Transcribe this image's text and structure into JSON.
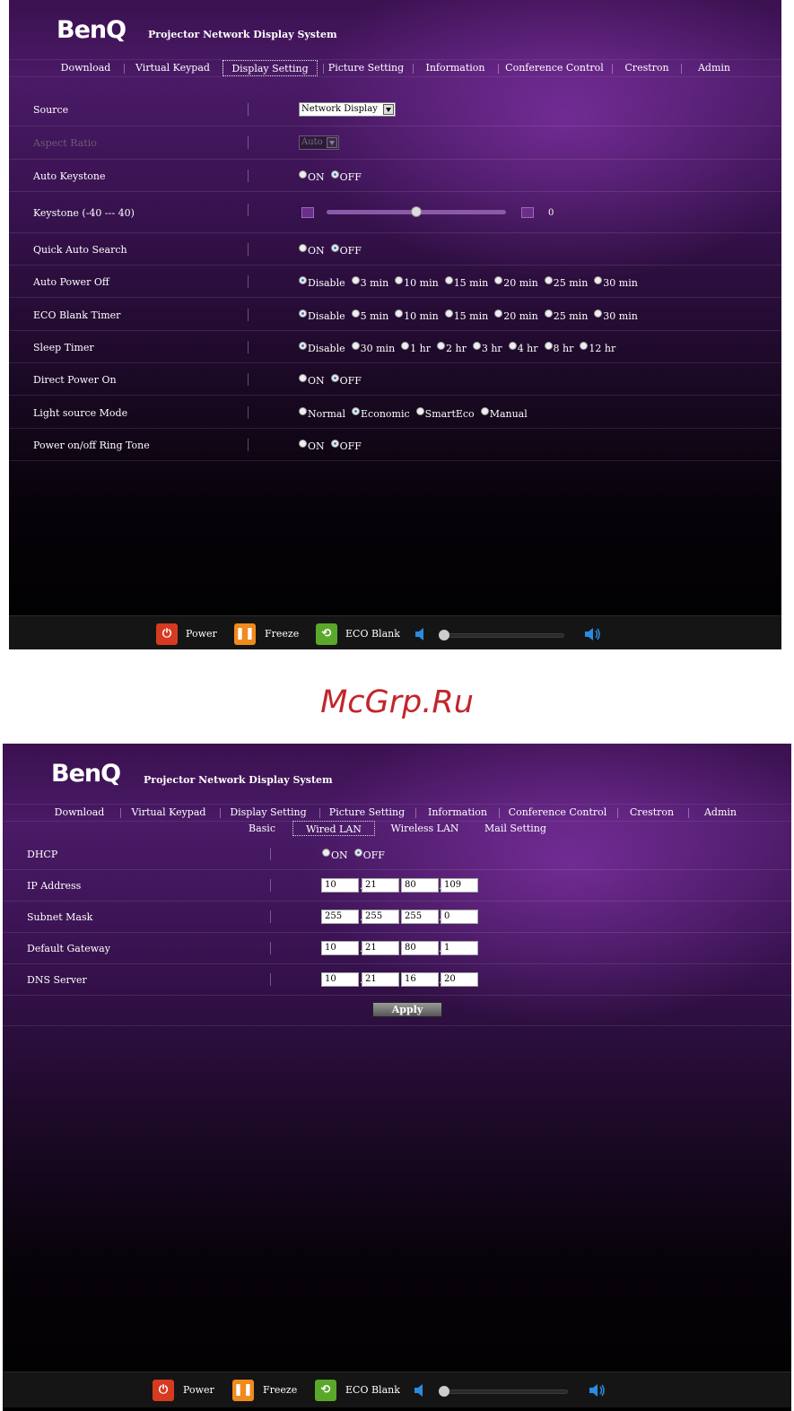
{
  "colors": {
    "accent_purple": "#4a1a66",
    "radio_checked": "#3a7ec0",
    "power_red": "#d63a20",
    "freeze_orange": "#f08a1c",
    "eco_green": "#5aa82a",
    "watermark": "#c2262b"
  },
  "screen1": {
    "brand": "BenQ",
    "subtitle": "Projector Network Display System",
    "tabs": [
      "Download",
      "Virtual Keypad",
      "Display Setting",
      "Picture Setting",
      "Information",
      "Conference Control",
      "Crestron",
      "Admin"
    ],
    "active_tab": "Display Setting",
    "rows": {
      "source": {
        "label": "Source",
        "value": "Network Display"
      },
      "aspect_ratio": {
        "label": "Aspect Ratio",
        "value": "Auto"
      },
      "auto_keystone": {
        "label": "Auto Keystone",
        "options": [
          "ON",
          "OFF"
        ],
        "selected": "OFF"
      },
      "keystone": {
        "label": "Keystone (-40 --- 40)",
        "value": "0",
        "level_fraction": 0.5
      },
      "quick_auto_search": {
        "label": "Quick Auto Search",
        "options": [
          "ON",
          "OFF"
        ],
        "selected": "OFF"
      },
      "auto_power_off": {
        "label": "Auto Power Off",
        "options": [
          "Disable",
          "3 min",
          "10 min",
          "15 min",
          "20 min",
          "25 min",
          "30 min"
        ],
        "selected": "Disable"
      },
      "eco_blank_timer": {
        "label": "ECO Blank Timer",
        "options": [
          "Disable",
          "5 min",
          "10 min",
          "15 min",
          "20 min",
          "25 min",
          "30 min"
        ],
        "selected": "Disable"
      },
      "sleep_timer": {
        "label": "Sleep Timer",
        "options": [
          "Disable",
          "30 min",
          "1 hr",
          "2 hr",
          "3 hr",
          "4 hr",
          "8 hr",
          "12 hr"
        ],
        "selected": "Disable"
      },
      "direct_power_on": {
        "label": "Direct Power On",
        "options": [
          "ON",
          "OFF"
        ],
        "selected": "OFF"
      },
      "light_source_mode": {
        "label": "Light source Mode",
        "options": [
          "Normal",
          "Economic",
          "SmartEco",
          "Manual"
        ],
        "selected": "Economic"
      },
      "ring_tone": {
        "label": "Power on/off Ring Tone",
        "options": [
          "ON",
          "OFF"
        ],
        "selected": "OFF"
      }
    },
    "footer": {
      "power": "Power",
      "freeze": "Freeze",
      "eco_blank": "ECO Blank",
      "volume_fraction": 0.0
    }
  },
  "watermark": "McGrp.Ru",
  "screen2": {
    "brand": "BenQ",
    "subtitle": "Projector Network Display System",
    "tabs": [
      "Download",
      "Virtual Keypad",
      "Display Setting",
      "Picture Setting",
      "Information",
      "Conference Control",
      "Crestron",
      "Admin"
    ],
    "subtabs": [
      "Basic",
      "Wired LAN",
      "Wireless LAN",
      "Mail Setting"
    ],
    "active_subtab": "Wired LAN",
    "rows": {
      "dhcp": {
        "label": "DHCP",
        "options": [
          "ON",
          "OFF"
        ],
        "selected": "OFF"
      },
      "ip_address": {
        "label": "IP Address",
        "octets": [
          "10",
          "21",
          "80",
          "109"
        ]
      },
      "subnet_mask": {
        "label": "Subnet Mask",
        "octets": [
          "255",
          "255",
          "255",
          "0"
        ]
      },
      "default_gateway": {
        "label": "Default Gateway",
        "octets": [
          "10",
          "21",
          "80",
          "1"
        ]
      },
      "dns_server": {
        "label": "DNS Server",
        "octets": [
          "10",
          "21",
          "16",
          "20"
        ]
      }
    },
    "apply_label": "Apply",
    "footer": {
      "power": "Power",
      "freeze": "Freeze",
      "eco_blank": "ECO Blank",
      "volume_fraction": 0.0
    }
  }
}
